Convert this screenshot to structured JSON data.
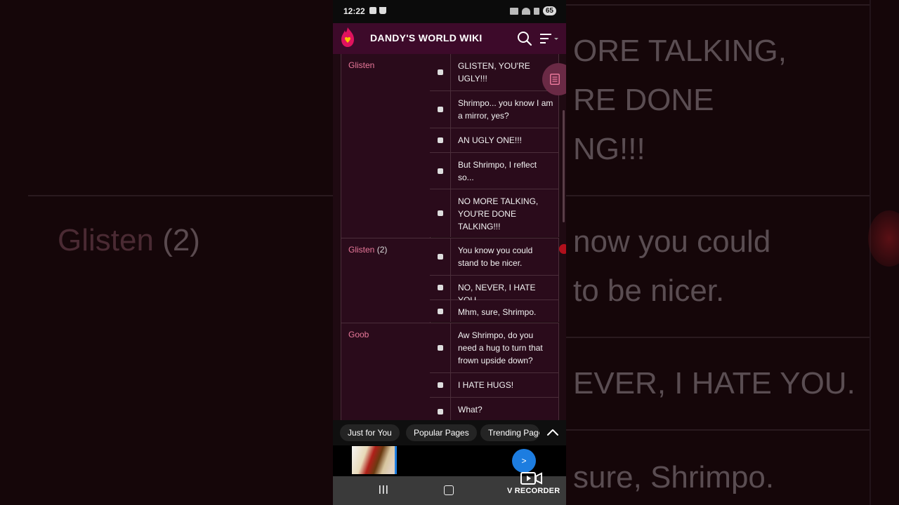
{
  "status_bar": {
    "time": "12:22",
    "battery": "65"
  },
  "header": {
    "title": "DANDY'S WORLD WIKI"
  },
  "table": {
    "rows": [
      {
        "name": "Glisten",
        "num": "",
        "lines": [
          "GLISTEN, YOU'RE UGLY!!!",
          "Shrimpo... you know I am a mirror, yes?",
          "AN UGLY ONE!!!",
          "But Shrimpo, I reflect so...",
          "NO MORE TALKING, YOU'RE DONE TALKING!!!"
        ]
      },
      {
        "name": "Glisten",
        "num": "(2)",
        "lines": [
          "You know you could stand to be nicer.",
          "NO, NEVER, I HATE YOU.",
          "Mhm, sure, Shrimpo."
        ]
      },
      {
        "name": "Goob",
        "num": "",
        "lines": [
          "Aw Shrimpo, do you need a hug to turn that frown upside down?",
          "I HATE HUGS!",
          "What?"
        ]
      }
    ]
  },
  "tabs": [
    "Just for You",
    "Popular Pages",
    "Trending Pages"
  ],
  "ad": {
    "button_label": ">"
  },
  "recorder_label": "V RECORDER",
  "background": {
    "left_name": "Glisten",
    "left_num": "(2)",
    "right_lines": [
      "ORE TALKING,",
      "RE DONE",
      "NG!!!",
      "now you could",
      "to be nicer.",
      "EVER, I HATE YOU.",
      "sure, Shrimpo."
    ]
  },
  "colors": {
    "header_bg": "#3d0a2a",
    "name_link": "#e9789a",
    "accent_blue": "#1d7de0"
  }
}
